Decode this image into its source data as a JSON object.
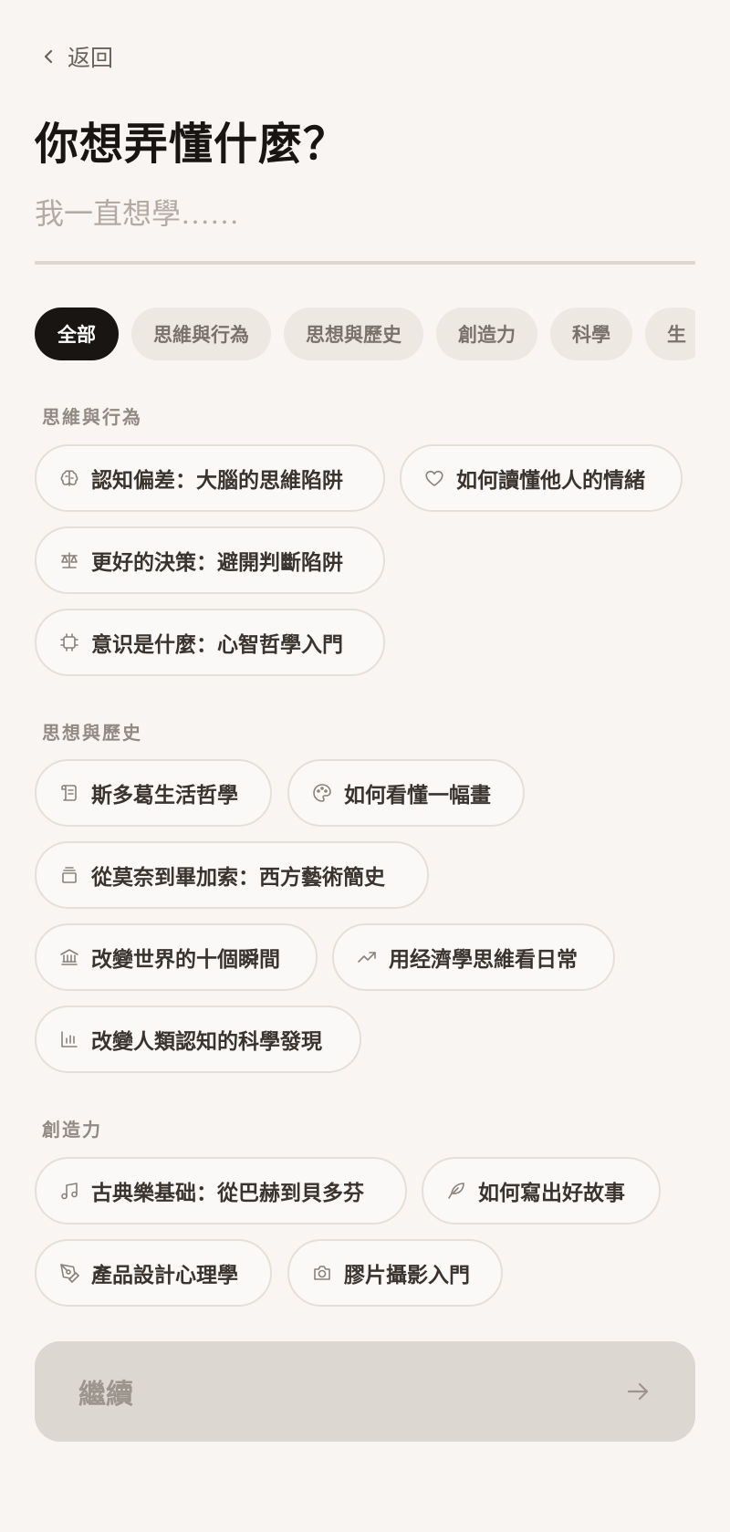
{
  "header": {
    "back_label": "返回",
    "title": "你想弄懂什麼？"
  },
  "search": {
    "placeholder": "我一直想學……",
    "value": ""
  },
  "tabs": [
    {
      "label": "全部",
      "active": true
    },
    {
      "label": "思維與行為",
      "active": false
    },
    {
      "label": "思想與歷史",
      "active": false
    },
    {
      "label": "創造力",
      "active": false
    },
    {
      "label": "科學",
      "active": false
    },
    {
      "label": "生",
      "active": false
    }
  ],
  "sections": [
    {
      "label": "思維與行為",
      "items": [
        {
          "label": "認知偏差：大腦的思維陷阱",
          "icon": "brain-icon"
        },
        {
          "label": "如何讀懂他人的情緒",
          "icon": "heart-icon"
        },
        {
          "label": "更好的決策：避開判斷陷阱",
          "icon": "scale-icon"
        },
        {
          "label": "意识是什麼：心智哲學入門",
          "icon": "chip-icon"
        }
      ]
    },
    {
      "label": "思想與歷史",
      "items": [
        {
          "label": "斯多葛生活哲學",
          "icon": "scroll-icon"
        },
        {
          "label": "如何看懂一幅畫",
          "icon": "palette-icon"
        },
        {
          "label": "從莫奈到畢加索：西方藝術簡史",
          "icon": "layers-icon"
        },
        {
          "label": "改變世界的十個瞬間",
          "icon": "landmark-icon"
        },
        {
          "label": "用经濟學思維看日常",
          "icon": "trending-up-icon"
        },
        {
          "label": "改變人類認知的科學發現",
          "icon": "bar-chart-icon"
        }
      ]
    },
    {
      "label": "創造力",
      "items": [
        {
          "label": "古典樂基础：從巴赫到貝多芬",
          "icon": "music-icon"
        },
        {
          "label": "如何寫出好故事",
          "icon": "feather-icon"
        },
        {
          "label": "產品設計心理學",
          "icon": "pen-tool-icon"
        },
        {
          "label": "膠片攝影入門",
          "icon": "camera-icon"
        }
      ]
    }
  ],
  "footer": {
    "continue_label": "繼續"
  },
  "colors": {
    "background": "#F8F5F2",
    "active_tab": "#181512",
    "chip_border": "#E5DFD8",
    "button_disabled": "#DCD7D1"
  }
}
